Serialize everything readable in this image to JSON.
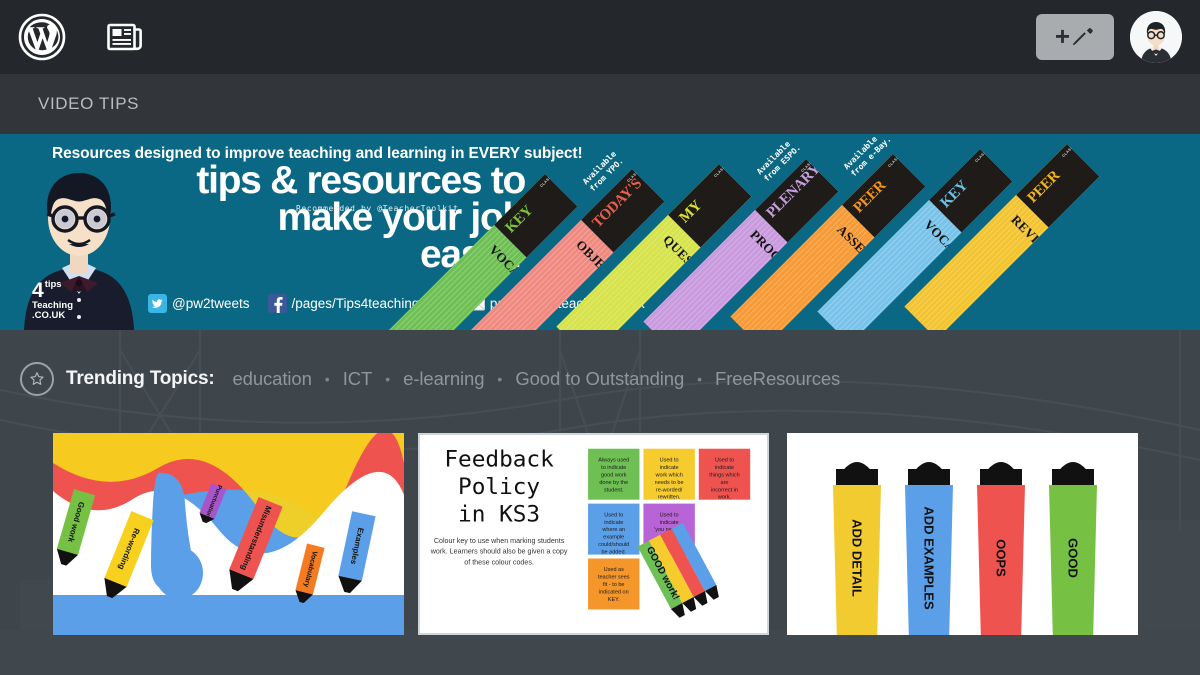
{
  "adminbar": {
    "wp_logo": "wordpress-logo-icon",
    "reader": "reader-newspaper-icon",
    "write_button": "write-post-button",
    "write_icon": "plus-pencil-icon",
    "avatar": "user-avatar"
  },
  "subnav": {
    "items": [
      {
        "label": "VIDEO TIPS"
      }
    ]
  },
  "banner": {
    "background_color": "#0a6884",
    "tagline": "Resources designed to improve teaching and learning in EVERY subject!",
    "headline_line1": "tips & resources to",
    "headline_line2": "make your job",
    "headline_line3": "easier",
    "recommendation": "Recommended by @TeacherToolkit",
    "logo": {
      "big": "4",
      "line1": "tips",
      "line2": "Teaching",
      "line3": ".CO.UK"
    },
    "social": [
      {
        "icon": "twitter-icon",
        "text": "@pw2tweets",
        "color": "#3ab5e5"
      },
      {
        "icon": "facebook-icon",
        "text": "/pages/Tips4teachingcouk",
        "color": "#3b5998"
      },
      {
        "icon": "email-icon",
        "text": "paul@tips4teaching.co.uk",
        "color": "#d94f3d"
      }
    ],
    "pads": [
      {
        "head_sub": "CLASSROOM SUPPORT",
        "head_main": "KEY",
        "head_main_color": "#7dc242",
        "label": "VOCABULARY",
        "color": "#6fc054",
        "avail": "Available\nfrom YPO."
      },
      {
        "head_sub": "CLASSROOM SUPPORT",
        "head_main": "TODAY'S",
        "head_main_color": "#e85f4d",
        "label": "OBJECTIVES",
        "color": "#f08a80",
        "avail": ""
      },
      {
        "head_sub": "CLASSROOM SUPPORT",
        "head_main": "MY",
        "head_main_color": "#d7e32a",
        "label": "QUESTIONS SHEET",
        "color": "#d7e34a",
        "avail": "Available\nfrom ESPO."
      },
      {
        "head_sub": "CLASSROOM SUPPORT",
        "head_main": "PLENARY",
        "head_main_color": "#c59ede",
        "label": "PROGRESS SHEET",
        "color": "#c99ade",
        "avail": "Available\nfrom e-Bay."
      },
      {
        "head_sub": "CLASSROOM SUPPORT",
        "head_main": "PEER",
        "head_main_color": "#f7941e",
        "label": "ASSESSMENT SUPPORT",
        "color": "#f89a35",
        "avail": ""
      },
      {
        "head_sub": "CLASSROOM SUPPORT",
        "head_main": "KEY",
        "head_main_color": "#6cc1e8",
        "label": "VOCABULARY REVIEW",
        "color": "#79c3ea",
        "avail": ""
      },
      {
        "head_sub": "CLASSROOM SUPPORT",
        "head_main": "PEER",
        "head_main_color": "#f2b61c",
        "label": "REVIEW SHEET",
        "color": "#f4c430",
        "avail": ""
      }
    ]
  },
  "trending": {
    "star_icon": "star-badge-icon",
    "label": "Trending Topics:",
    "separator": "•",
    "topics": [
      {
        "label": "education"
      },
      {
        "label": "ICT"
      },
      {
        "label": "e-learning"
      },
      {
        "label": "Good to Outstanding"
      },
      {
        "label": "FreeResources"
      }
    ]
  },
  "thumbnails": [
    {
      "name": "highlighters-scattered-thumbnail",
      "kind": "highlighters-scatter",
      "pens": [
        {
          "label": "Good work",
          "color": "#76c043"
        },
        {
          "label": "Re-wording",
          "color": "#f7d11e"
        },
        {
          "label": "Punctuation",
          "color": "#a855c9"
        },
        {
          "label": "Misunderstanding",
          "color": "#ef5350"
        },
        {
          "label": "Vocabulary",
          "color": "#f47b20"
        },
        {
          "label": "Examples",
          "color": "#5b9fe8"
        }
      ],
      "blobs": [
        "#ef5350",
        "#f7d11e",
        "#5b9fe8"
      ]
    },
    {
      "name": "feedback-policy-ks3-thumbnail",
      "kind": "feedback-policy",
      "title_line1": "Feedback",
      "title_line2": "Policy",
      "title_line3": "in KS3",
      "subtitle": "Colour key to use when marking students work. Learners should also be given a copy of these colour codes.",
      "cells": [
        {
          "color": "#6fc054",
          "text": "Always used to indicate good work done by the student."
        },
        {
          "color": "#f5cb2e",
          "text": "Used to indicate work which needs to be re-worded/ rewritten."
        },
        {
          "color": "#ef5350",
          "text": "Used to indicate things which are incorrect in work."
        },
        {
          "color": "#5b9fe8",
          "text": "Used to indicate where an example could/should be added."
        },
        {
          "color": "#b863d6",
          "text": "Used to indicate 'you need to see the teacher about this'."
        },
        {
          "color": "#f4962a",
          "text": "Used as teacher sees fit - to be indicated on KEY."
        }
      ],
      "fan_label": "GOOD work!",
      "fan_colors": [
        "#6fc054",
        "#f5cb2e",
        "#ef5350",
        "#5b9fe8"
      ]
    },
    {
      "name": "four-highlighters-thumbnail",
      "kind": "highlighters-row",
      "pens": [
        {
          "label": "ADD DETAIL",
          "color": "#f2cb30"
        },
        {
          "label": "ADD EXAMPLES",
          "color": "#5b9fe8"
        },
        {
          "label": "OOPS",
          "color": "#ef5350"
        },
        {
          "label": "GOOD",
          "color": "#76c043"
        }
      ]
    }
  ],
  "colors": {
    "adminbar": "#24282c",
    "subnav": "#32363a",
    "banner": "#0a6884",
    "page_bg": "#3b4248",
    "accent_text": "#8e979e"
  }
}
